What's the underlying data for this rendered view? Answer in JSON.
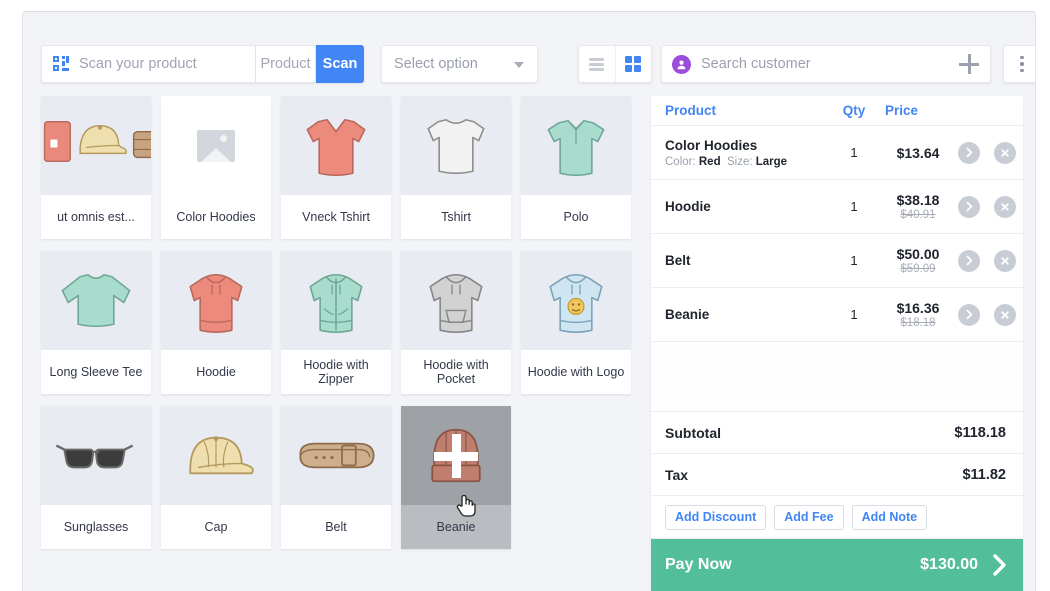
{
  "toolbar": {
    "scan_icon": "barcode-scan-icon",
    "scan_placeholder": "Scan your product",
    "scan_value": "",
    "segment_product": "Product",
    "segment_scan": "Scan",
    "select_option_label": "Select option",
    "view_list_icon": "list-view-icon",
    "view_grid_icon": "grid-view-icon",
    "active_view": "grid",
    "accent_blue": "#4285f4"
  },
  "customer": {
    "avatar_icon": "user-avatar-icon",
    "placeholder": "Search customer",
    "value": "",
    "add_icon": "plus-icon",
    "kebab_icon": "more-vertical-icon",
    "avatar_color": "#9c4ddb"
  },
  "products": [
    {
      "name": "ut omnis est...",
      "image": "product-collage-image",
      "placeholder": false
    },
    {
      "name": "Color Hoodies",
      "image": "image-placeholder-icon",
      "placeholder": true
    },
    {
      "name": "Vneck Tshirt",
      "image": "vneck-tshirt-image",
      "placeholder": false
    },
    {
      "name": "Tshirt",
      "image": "tshirt-image",
      "placeholder": false
    },
    {
      "name": "Polo",
      "image": "polo-shirt-image",
      "placeholder": false
    },
    {
      "name": "Long Sleeve Tee",
      "image": "long-sleeve-tee-image",
      "placeholder": false
    },
    {
      "name": "Hoodie",
      "image": "hoodie-image",
      "placeholder": false
    },
    {
      "name": "Hoodie with Zipper",
      "image": "hoodie-zipper-image",
      "placeholder": false
    },
    {
      "name": "Hoodie with Pocket",
      "image": "hoodie-pocket-image",
      "placeholder": false
    },
    {
      "name": "Hoodie with Logo",
      "image": "hoodie-logo-image",
      "placeholder": false
    },
    {
      "name": "Sunglasses",
      "image": "sunglasses-image",
      "placeholder": false
    },
    {
      "name": "Cap",
      "image": "cap-image",
      "placeholder": false
    },
    {
      "name": "Belt",
      "image": "belt-image",
      "placeholder": false
    },
    {
      "name": "Beanie",
      "image": "beanie-image",
      "placeholder": false,
      "hovered": true
    }
  ],
  "cart": {
    "columns": {
      "product": "Product",
      "qty": "Qty",
      "price": "Price"
    },
    "items": [
      {
        "name": "Color Hoodies",
        "variant_label_1": "Color:",
        "variant_value_1": "Red",
        "variant_label_2": "Size:",
        "variant_value_2": "Large",
        "qty": "1",
        "price": "$13.64",
        "old_price": ""
      },
      {
        "name": "Hoodie",
        "qty": "1",
        "price": "$38.18",
        "old_price": "$40.91"
      },
      {
        "name": "Belt",
        "qty": "1",
        "price": "$50.00",
        "old_price": "$59.09"
      },
      {
        "name": "Beanie",
        "qty": "1",
        "price": "$16.36",
        "old_price": "$18.18"
      }
    ],
    "row_detail_icon": "chevron-right-icon",
    "row_remove_icon": "close-circle-icon",
    "subtotal_label": "Subtotal",
    "subtotal_value": "$118.18",
    "tax_label": "Tax",
    "tax_value": "$11.82",
    "add_discount_label": "Add Discount",
    "add_fee_label": "Add Fee",
    "add_note_label": "Add Note",
    "pay_now_label": "Pay Now",
    "pay_now_amount": "$130.00",
    "pay_now_icon": "chevron-right-icon",
    "pay_now_color": "#53bf9a"
  },
  "cursor": {
    "icon": "hand-pointer-cursor"
  }
}
